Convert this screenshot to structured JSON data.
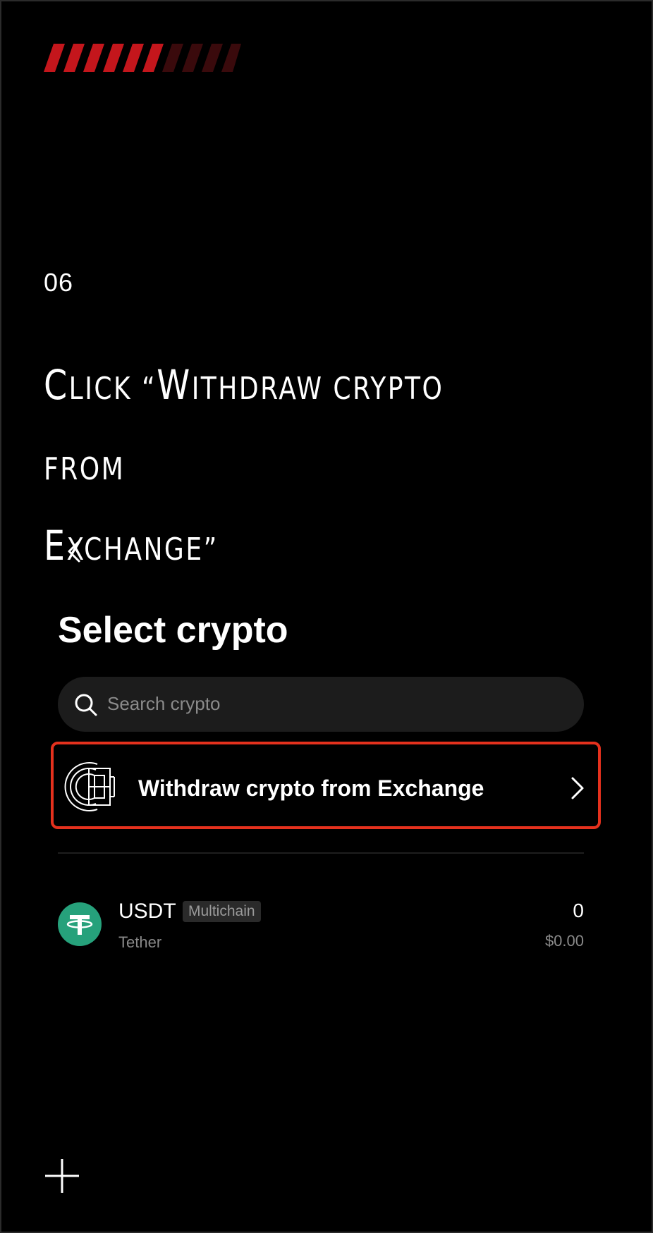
{
  "step": {
    "number": "06"
  },
  "heading": {
    "line1_cap": "C",
    "line1_small": "LICK “",
    "line1_cap2": "W",
    "line1_small2": "ITHDRAW CRYPTO FROM",
    "line2_cap": "E",
    "line2_small": "XCHANGE”"
  },
  "screen": {
    "back_icon": "chevron-left-icon",
    "title": "Select crypto",
    "search": {
      "placeholder": "Search crypto",
      "icon": "search-icon"
    },
    "withdraw_option": {
      "label": "Withdraw crypto from Exchange",
      "icon": "exchange-logo-icon",
      "highlight_color": "#e5311d"
    },
    "assets": [
      {
        "symbol": "USDT",
        "badge": "Multichain",
        "name": "Tether",
        "amount": "0",
        "fiat": "$0.00",
        "logo": "tether-icon",
        "logo_color": "#26a17b"
      }
    ]
  },
  "decor": {
    "stripe_color": "#c4161c",
    "plus_icon": "plus-icon"
  }
}
